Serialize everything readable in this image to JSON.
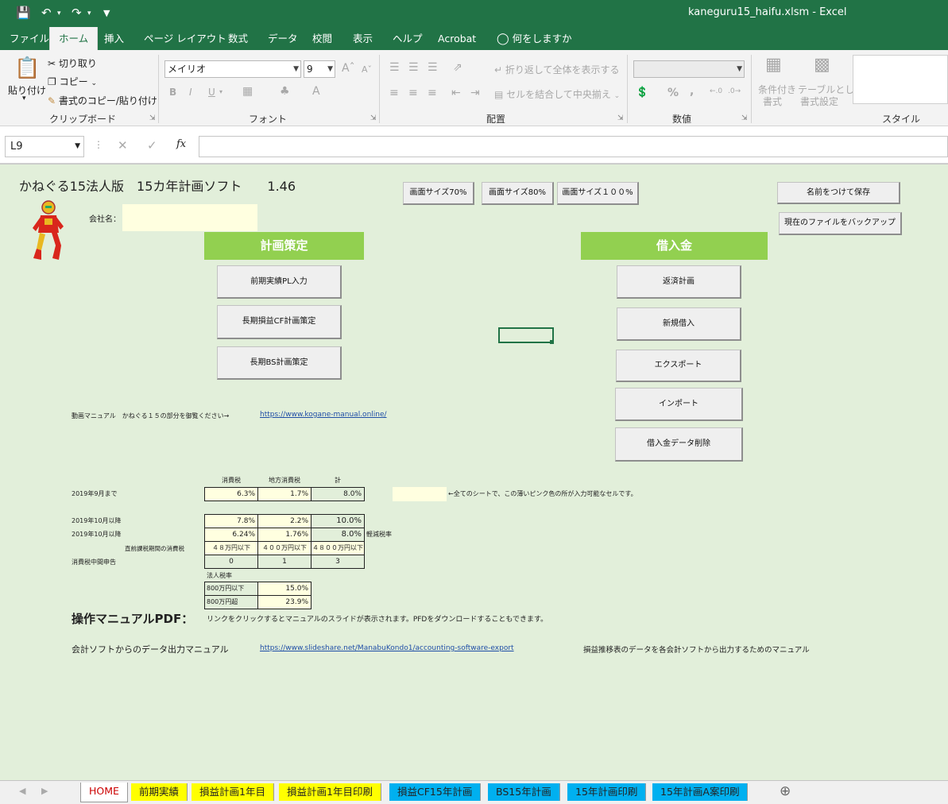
{
  "titlebar": {
    "title": "kaneguru15_haifu.xlsm  -  Excel",
    "save_icon": "save-icon",
    "undo_icon": "undo-icon",
    "redo_icon": "redo-icon",
    "customize_icon": "customize-quick-access-icon"
  },
  "ribbon_tabs": [
    {
      "label": "ファイル"
    },
    {
      "label": "ホーム"
    },
    {
      "label": "挿入"
    },
    {
      "label": "ページ レイアウト"
    },
    {
      "label": "数式"
    },
    {
      "label": "データ"
    },
    {
      "label": "校閲"
    },
    {
      "label": "表示"
    },
    {
      "label": "ヘルプ"
    },
    {
      "label": "Acrobat"
    },
    {
      "label": "何をしますか"
    }
  ],
  "ribbon": {
    "clipboard": {
      "paste": "貼り付け",
      "cut": "切り取り",
      "copy": "コピー",
      "format_painter": "書式のコピー/貼り付け",
      "group": "クリップボード"
    },
    "font": {
      "name": "メイリオ",
      "size": "9",
      "bold": "B",
      "italic": "I",
      "underline": "U",
      "group": "フォント"
    },
    "alignment": {
      "wrap": "折り返して全体を表示する",
      "merge": "セルを結合して中央揃え",
      "group": "配置"
    },
    "number": {
      "percent": "%",
      "comma": ",",
      "group": "数値"
    },
    "styles": {
      "conditional": "条件付き",
      "conditional2": "書式",
      "table": "テーブルとして",
      "table2": "書式設定",
      "group": "スタイル"
    }
  },
  "formula_bar": {
    "name_box": "L9",
    "cancel": "✕",
    "enter": "✓",
    "fx": "fx",
    "value": ""
  },
  "sheet": {
    "title": "かねぐる15法人版　15カ年計画ソフト　　1.46",
    "company_label": "会社名：",
    "company_value": "",
    "zoom_buttons": [
      "画面サイズ70%",
      "画面サイズ80%",
      "画面サイズ１００%"
    ],
    "save_as_button": "名前をつけて保存",
    "backup_button": "現在のファイルをバックアップ",
    "plan_header": "計画策定",
    "plan_buttons": [
      "前期実績PL入力",
      "長期損益CF計画策定",
      "長期BS計画策定"
    ],
    "loan_header": "借入金",
    "loan_buttons": [
      "返済計画",
      "新規借入",
      "エクスポート",
      "インポート",
      "借入金データ削除"
    ],
    "video_manual_text": "動画マニュアル　かねぐる１５の部分を御覧ください→",
    "video_manual_url": "https://www.kogane-manual.online/",
    "tax_headers": [
      "消費税",
      "地方消費税",
      "計"
    ],
    "tax_rows": [
      {
        "label": "2019年9月まで",
        "values": [
          "6.3%",
          "1.7%",
          "8.0%"
        ]
      },
      {
        "label": "2019年10月以降",
        "values": [
          "7.8%",
          "2.2%",
          "10.0%"
        ]
      },
      {
        "label": "2019年10月以降",
        "values": [
          "6.24%",
          "1.76%",
          "8.0%"
        ],
        "note": "軽減税率"
      }
    ],
    "input_note": "←全てのシートで、この薄いピンク色の所が入力可能なセルです。",
    "prior_tax_label": "直前課税期間の消費税",
    "prior_tax_values": [
      "４８万円以下",
      "４００万円以下",
      "４８００万円以下"
    ],
    "interim_label": "消費税中間申告",
    "interim_values": [
      "0",
      "1",
      "3"
    ],
    "corp_tax_label": "法人税率",
    "corp_tax_rows": [
      {
        "label": "800万円以下",
        "value": "15.0%"
      },
      {
        "label": "800万円超",
        "value": "23.9%"
      }
    ],
    "pdf_manual_title": "操作マニュアルPDF：",
    "pdf_manual_desc": "リンクをクリックするとマニュアルのスライドが表示されます。PFDをダウンロードすることもできます。",
    "export_manual_label": "会計ソフトからのデータ出力マニュアル",
    "export_manual_url": "https://www.slideshare.net/ManabuKondo1/accounting-software-export",
    "export_manual_note": "損益推移表のデータを各会計ソフトから出力するためのマニュアル"
  },
  "sheet_tabs": [
    {
      "label": "HOME",
      "color": "#ffffff"
    },
    {
      "label": "前期実績",
      "color": "#ffff00"
    },
    {
      "label": "損益計画1年目",
      "color": "#ffff00"
    },
    {
      "label": "損益計画1年目印刷",
      "color": "#ffff00"
    },
    {
      "label": "損益CF15年計画",
      "color": "#00b0f0"
    },
    {
      "label": "BS15年計画",
      "color": "#00b0f0"
    },
    {
      "label": "15年計画印刷",
      "color": "#00b0f0"
    },
    {
      "label": "15年計画A案印刷",
      "color": "#00b0f0"
    }
  ],
  "add_sheet_icon": "add-sheet-icon",
  "colors": {
    "excel_green": "#217346",
    "sheet_bg": "#e2efda",
    "header_green": "#92d050",
    "input_yellow": "#ffffe0"
  }
}
